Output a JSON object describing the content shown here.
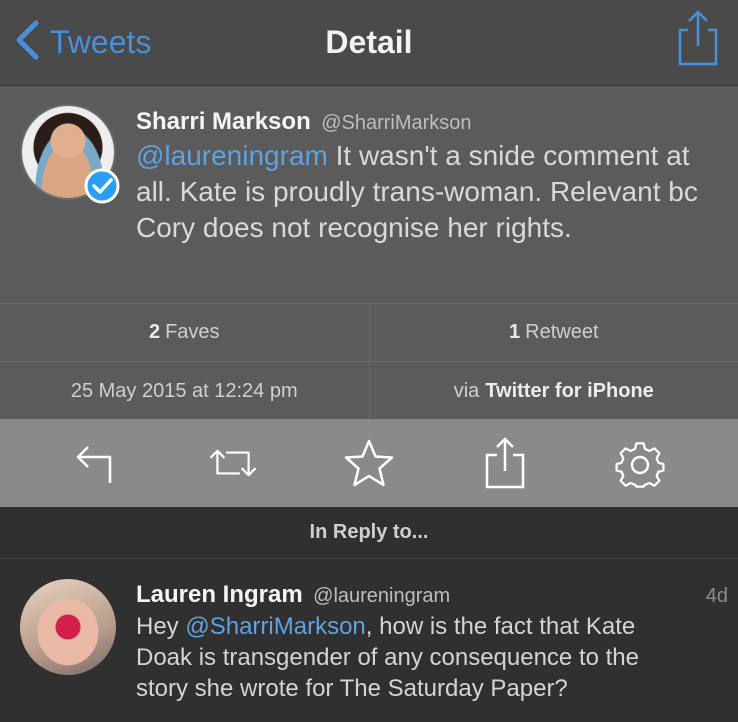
{
  "navbar": {
    "back_label": "Tweets",
    "title": "Detail",
    "icons": {
      "back": "chevron-left-icon",
      "share": "share-icon"
    },
    "accent_color": "#4a90d9"
  },
  "tweet": {
    "author_name": "Sharri Markson",
    "author_handle": "@SharriMarkson",
    "verified": true,
    "mention": "@laureningram",
    "text": " It wasn't a snide comment at all. Kate is proudly trans-woman. Relevant bc Cory does not recognise her rights."
  },
  "stats": {
    "faves_count": "2",
    "faves_label": "Faves",
    "retweets_count": "1",
    "retweets_label": "Retweet",
    "timestamp": "25 May 2015 at 12:24 pm",
    "via_label": "via",
    "client": "Twitter for iPhone"
  },
  "actions": [
    {
      "name": "reply-icon"
    },
    {
      "name": "retweet-icon"
    },
    {
      "name": "favorite-star-icon"
    },
    {
      "name": "share-icon"
    },
    {
      "name": "settings-gear-icon"
    }
  ],
  "reply_header": "In Reply to...",
  "reply": {
    "author_name": "Lauren Ingram",
    "author_handle": "@laureningram",
    "time": "4d",
    "text_before": "Hey ",
    "mention": "@SharriMarkson",
    "text_after": ", how is the fact that Kate Doak is transgender of any consequence to the story she wrote for The Saturday Paper?"
  }
}
